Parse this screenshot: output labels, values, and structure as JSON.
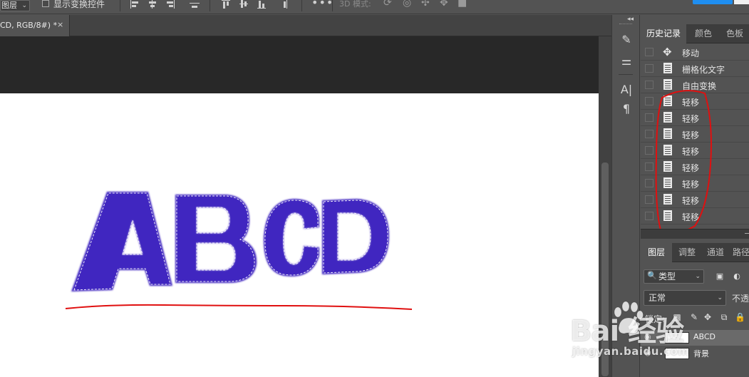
{
  "options_bar": {
    "layer_dropdown": "图层",
    "show_transform_controls": "显示变换控件",
    "more": "•••",
    "mode_3d_label": "3D 模式:"
  },
  "document_tab": {
    "title": "CD, RGB/8#) *",
    "close": "×"
  },
  "tools": {
    "character_label": "A|",
    "paragraph_label": "¶"
  },
  "history_panel": {
    "tabs": [
      "历史记录",
      "颜色",
      "色板"
    ],
    "items": [
      {
        "label": "移动",
        "icon": "move-icon"
      },
      {
        "label": "栅格化文字",
        "icon": "document-icon"
      },
      {
        "label": "自由变换",
        "icon": "document-icon"
      },
      {
        "label": "轻移",
        "icon": "document-icon"
      },
      {
        "label": "轻移",
        "icon": "document-icon"
      },
      {
        "label": "轻移",
        "icon": "document-icon"
      },
      {
        "label": "轻移",
        "icon": "document-icon"
      },
      {
        "label": "轻移",
        "icon": "document-icon"
      },
      {
        "label": "轻移",
        "icon": "document-icon"
      },
      {
        "label": "轻移",
        "icon": "document-icon"
      },
      {
        "label": "轻移",
        "icon": "document-icon"
      }
    ]
  },
  "layers_panel": {
    "tabs": [
      "图层",
      "调整",
      "通道",
      "路径"
    ],
    "filter_label": "类型",
    "blend_mode": "正常",
    "opacity_label": "不透明",
    "lock_label": "锁定:",
    "layers": [
      {
        "name": "ABCD",
        "selected": true
      },
      {
        "name": "背景",
        "selected": false
      }
    ]
  },
  "canvas": {
    "artwork_text": "ABCD",
    "text_color": "#4125c0",
    "annotation_color": "#e01010"
  },
  "watermark": {
    "logo": "Bai  经验",
    "url": "jingyan.baidu.com"
  }
}
